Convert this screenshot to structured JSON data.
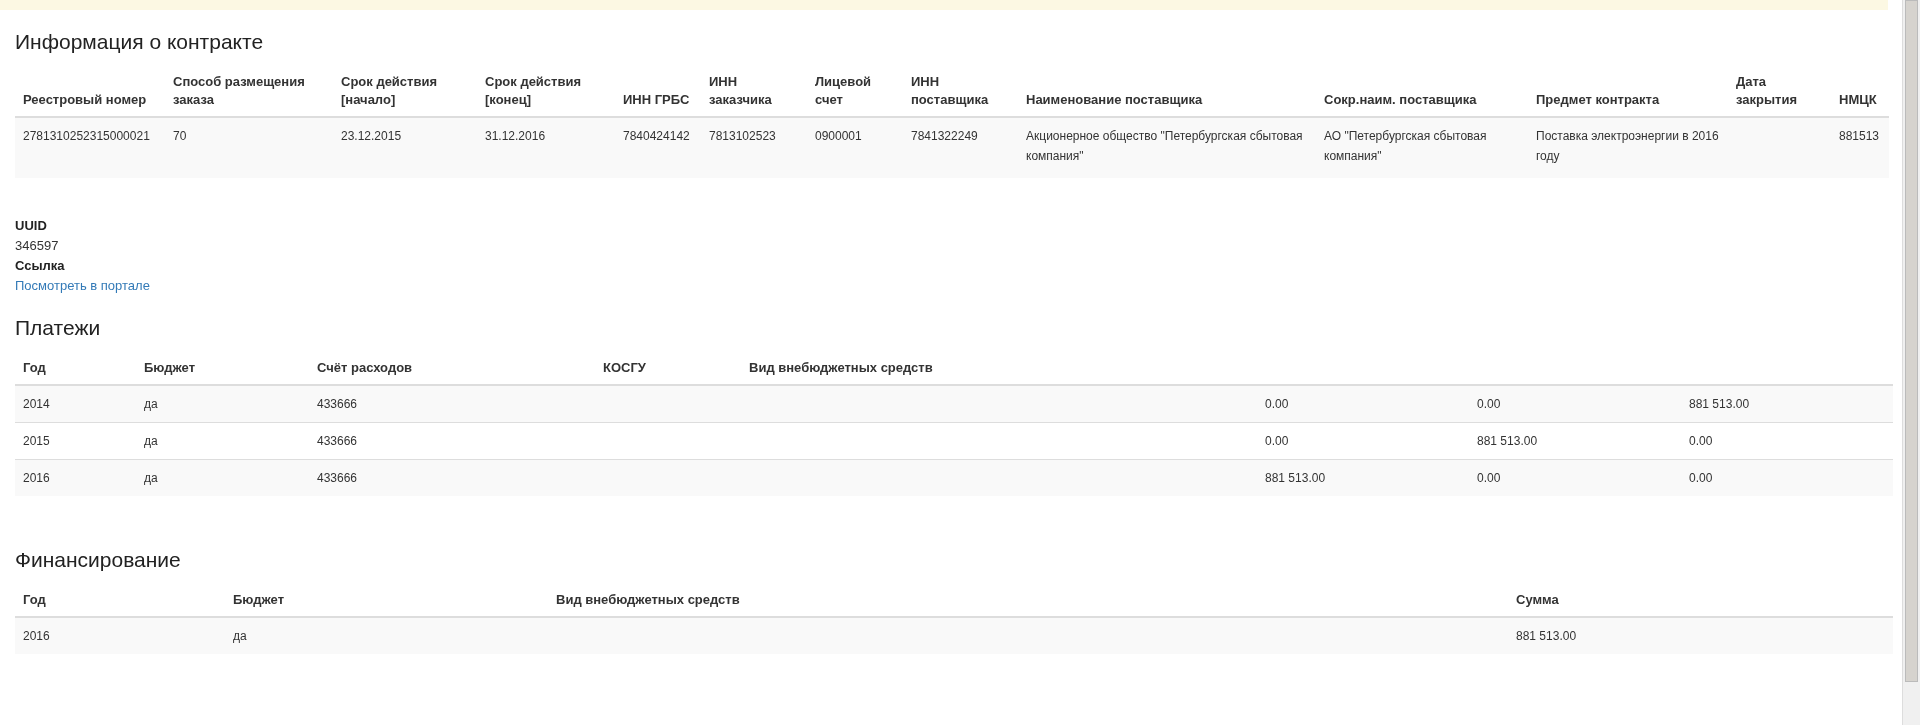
{
  "contract": {
    "title": "Информация о контракте",
    "columns": [
      "Реестровый номер",
      "Способ размещения заказа",
      "Срок действия [начало]",
      "Срок действия [конец]",
      "ИНН ГРБС",
      "ИНН заказчика",
      "Лицевой счет",
      "ИНН поставщика",
      "Наименование поставщика",
      "Сокр.наим. поставщика",
      "Предмет контракта",
      "Дата закрытия",
      "НМЦК"
    ],
    "rows": [
      {
        "registry_number": "2781310252315000021",
        "placement_method": "70",
        "start_date": "23.12.2015",
        "end_date": "31.12.2016",
        "grbs_inn": "7840424142",
        "customer_inn": "7813102523",
        "personal_account": "0900001",
        "supplier_inn": "7841322249",
        "supplier_name": "Акционерное общество \"Петербургская сбытовая компания\"",
        "supplier_short_name": "АО \"Петербургская сбытовая компания\"",
        "subject": "Поставка электроэнергии в 2016 году",
        "nmck": "881513"
      }
    ]
  },
  "details": [
    {
      "label": "UUID",
      "value": "346597",
      "kind": "text"
    },
    {
      "label": "Ссылка",
      "value": "Посмотреть в портале",
      "kind": "link"
    }
  ],
  "payments": {
    "title": "Платежи",
    "columns": [
      "Год",
      "Бюджет",
      "Счёт расходов",
      "КОСГУ",
      "Вид внебюджетных средств"
    ],
    "rows": [
      {
        "year": "2014",
        "budget": "да",
        "expense_account": "433666",
        "column_6": "0.00",
        "column_7": "0.00",
        "column_8": "881 513.00"
      },
      {
        "year": "2015",
        "budget": "да",
        "expense_account": "433666",
        "column_6": "0.00",
        "column_7": "881 513.00",
        "column_8": "0.00"
      },
      {
        "year": "2016",
        "budget": "да",
        "expense_account": "433666",
        "column_6": "881 513.00",
        "column_7": "0.00",
        "column_8": "0.00"
      }
    ]
  },
  "financing": {
    "title": "Финансирование",
    "columns": [
      "Год",
      "Бюджет",
      "Вид внебюджетных средств",
      "Сумма"
    ],
    "rows": [
      {
        "year": "2016",
        "budget": "да",
        "sum": "881 513.00"
      }
    ]
  }
}
